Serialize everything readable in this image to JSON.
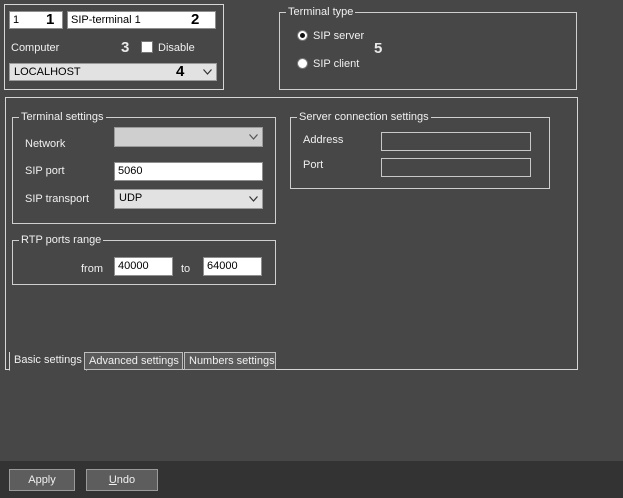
{
  "object": {
    "id_value": "1",
    "name_value": "SIP-terminal 1",
    "computer_label": "Computer",
    "disable_label": "Disable",
    "disable_checked": false,
    "computer_value": "LOCALHOST"
  },
  "callouts": [
    "1",
    "2",
    "3",
    "4",
    "5"
  ],
  "terminal_type": {
    "title": "Terminal type",
    "options": [
      {
        "label": "SIP server",
        "selected": true
      },
      {
        "label": "SIP client",
        "selected": false
      }
    ]
  },
  "terminal_settings": {
    "title": "Terminal settings",
    "network_label": "Network",
    "network_value": "",
    "sip_port_label": "SIP port",
    "sip_port_value": "5060",
    "sip_transport_label": "SIP transport",
    "sip_transport_value": "UDP"
  },
  "rtp": {
    "title": "RTP ports range",
    "from_label": "from",
    "from_value": "40000",
    "to_label": "to",
    "to_value": "64000"
  },
  "server_connection": {
    "title": "Server connection settings",
    "address_label": "Address",
    "address_value": "",
    "port_label": "Port",
    "port_value": ""
  },
  "tabs": [
    "Basic settings",
    "Advanced settings",
    "Numbers settings"
  ],
  "active_tab": 0,
  "buttons": {
    "apply": "Apply",
    "undo_prefix": "U",
    "undo_rest": "ndo"
  },
  "colors": {
    "background": "#474747",
    "bottom_bar": "#333333",
    "callout_text": "#000000"
  }
}
